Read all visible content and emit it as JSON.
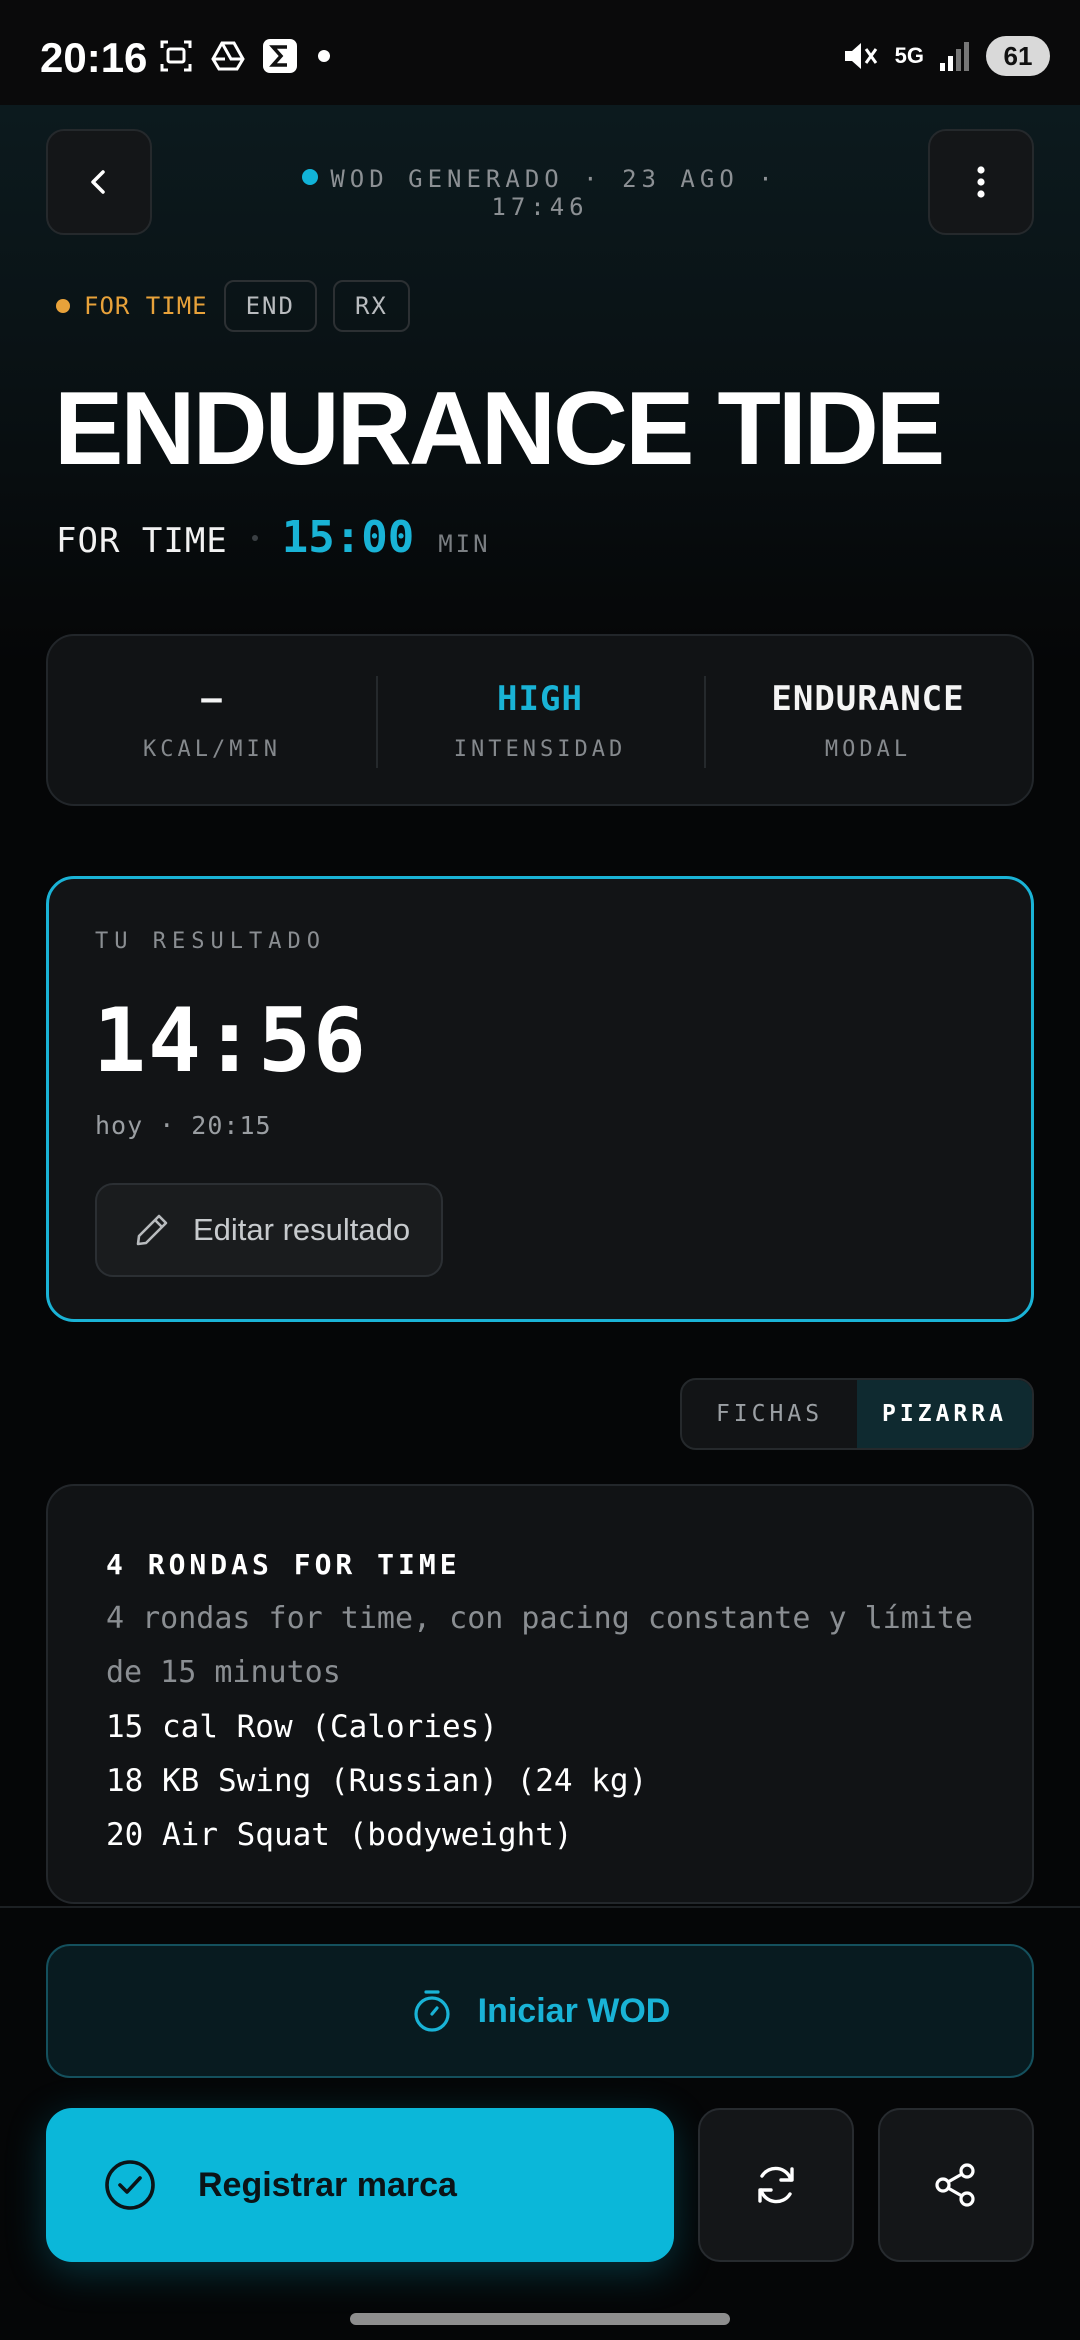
{
  "status_bar": {
    "time": "20:16",
    "network": "5G",
    "battery": "61",
    "icons": [
      "screenshot-icon",
      "drive-icon",
      "sigma-app-icon",
      "notification-dot",
      "mute-icon",
      "signal-icon",
      "battery-icon"
    ]
  },
  "header": {
    "info": "WOD GENERADO · 23 AGO · 17:46",
    "back_icon": "chevron-left-icon",
    "menu_icon": "more-vertical-icon"
  },
  "tags": {
    "type": "FOR TIME",
    "chips": [
      "END",
      "RX"
    ]
  },
  "workout": {
    "title": "ENDURANCE TIDE",
    "format": "FOR TIME",
    "time_cap": "15:00",
    "time_unit": "MIN"
  },
  "stats": [
    {
      "value": "—",
      "label": "KCAL/MIN"
    },
    {
      "value": "HIGH",
      "label": "INTENSIDAD"
    },
    {
      "value": "ENDURANCE",
      "label": "MODAL"
    }
  ],
  "result": {
    "label": "TU RESULTADO",
    "time": "14:56",
    "when": "hoy · 20:15",
    "edit_label": "Editar resultado"
  },
  "view_toggle": {
    "options": [
      "FICHAS",
      "PIZARRA"
    ],
    "selected": "PIZARRA"
  },
  "board": {
    "heading": "4 RONDAS FOR TIME",
    "description": "4 rondas for time, con pacing constante y límite de 15 minutos",
    "movements": [
      "15 cal Row (Calories)",
      "18 KB Swing (Russian) (24 kg)",
      "20 Air Squat (bodyweight)"
    ]
  },
  "actions": {
    "start": "Iniciar WOD",
    "register": "Registrar marca",
    "refresh_icon": "refresh-icon",
    "share_icon": "share-icon"
  },
  "colors": {
    "accent": "#0bb7d9",
    "accent_text": "#19b3d6",
    "warning": "#e8a23a",
    "background": "#050607",
    "card": "#111315"
  }
}
